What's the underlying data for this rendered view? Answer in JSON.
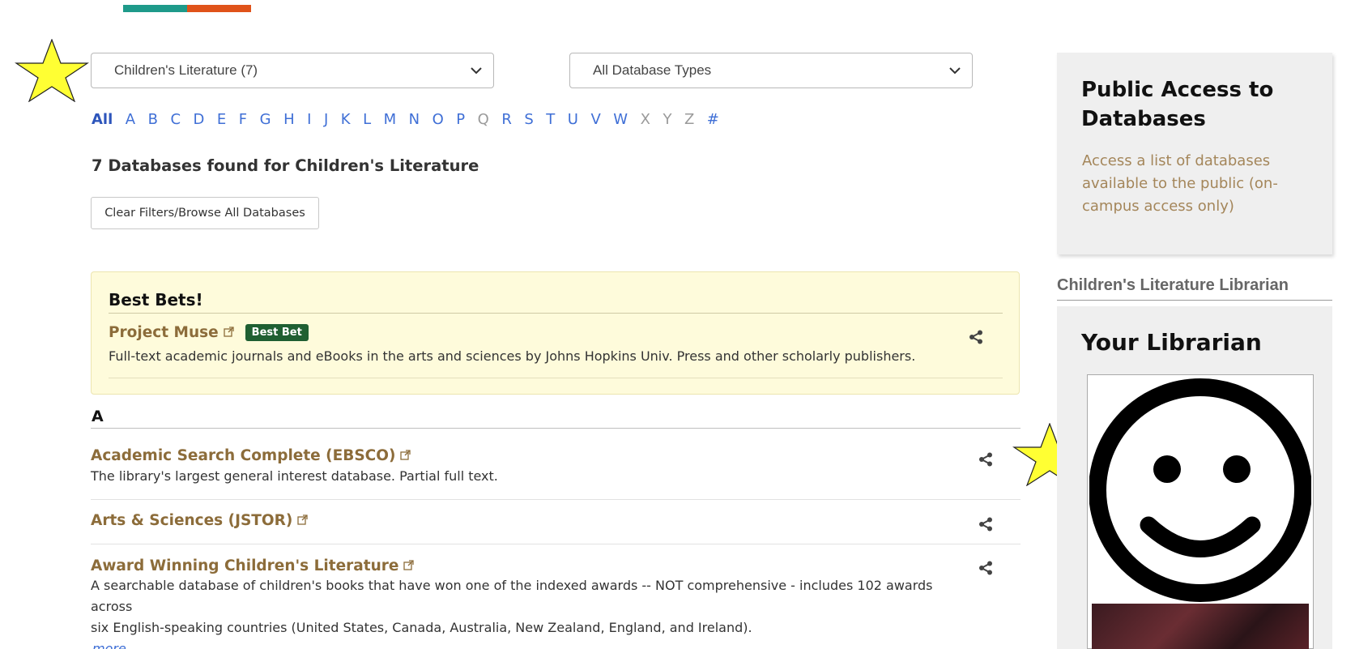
{
  "brand": {
    "colors": [
      "#1e9a8a",
      "#e0531a"
    ]
  },
  "annotations": {
    "star_color": "#ffff33"
  },
  "filters": {
    "subject_selected": "Children's Literature (7)",
    "type_selected": "All Database Types"
  },
  "az": {
    "letters": [
      "All",
      "A",
      "B",
      "C",
      "D",
      "E",
      "F",
      "G",
      "H",
      "I",
      "J",
      "K",
      "L",
      "M",
      "N",
      "O",
      "P",
      "Q",
      "R",
      "S",
      "T",
      "U",
      "V",
      "W",
      "X",
      "Y",
      "Z",
      "#"
    ],
    "active": "All",
    "disabled": [
      "Q",
      "X",
      "Y",
      "Z"
    ]
  },
  "results": {
    "heading": "7 Databases found for Children's Literature",
    "clear_button": "Clear Filters/Browse All Databases"
  },
  "best_bets": {
    "heading": "Best Bets!",
    "title": "Project Muse",
    "badge": "Best Bet",
    "description": "Full-text academic journals and eBooks in the arts and sciences by Johns Hopkins Univ. Press and other scholarly publishers."
  },
  "section_letter": "A",
  "databases": [
    {
      "title": "Academic Search Complete (EBSCO)",
      "description": "The library's largest general interest database. Partial full text."
    },
    {
      "title": "Arts & Sciences (JSTOR)",
      "description": ""
    },
    {
      "title": "Award Winning Children's Literature",
      "description_line1": "A searchable database of children's books that have won one of the indexed awards -- NOT comprehensive - includes 102 awards across",
      "description_line2": "six English-speaking countries (United States, Canada, Australia, New Zealand, England, and Ireland).",
      "more": "more..."
    }
  ],
  "sidebar": {
    "public_access": {
      "title": "Public Access to Databases",
      "description": "Access a list of databases available to the public (on-campus access only)"
    },
    "librarian_heading": "Children's Literature Librarian",
    "librarian_box_title": "Your Librarian"
  }
}
